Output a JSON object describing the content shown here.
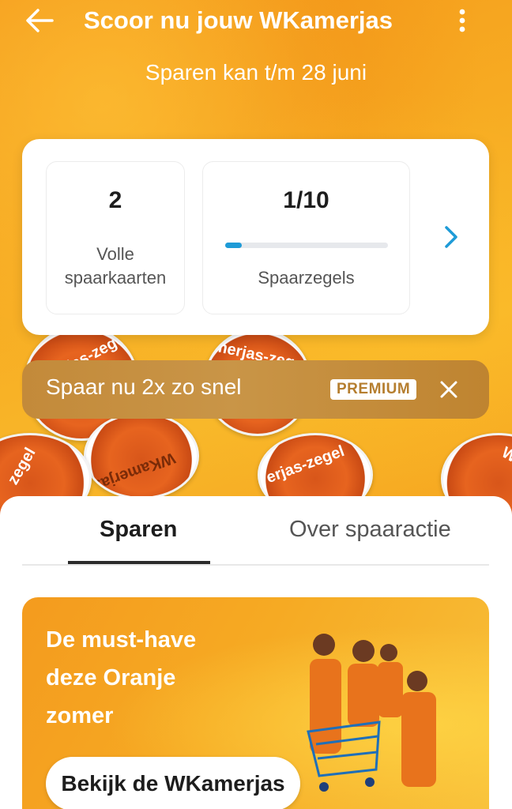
{
  "header": {
    "title": "Scoor nu jouw WKamerjas",
    "subtitle": "Sparen kan t/m 28 juni"
  },
  "stats": {
    "cards": {
      "value": "2",
      "label_line1": "Volle",
      "label_line2": "spaarkaarten"
    },
    "stamps": {
      "value": "1/10",
      "label": "Spaarzegels",
      "progress": 0.1
    }
  },
  "premium": {
    "text": "Spaar nu 2x zo snel",
    "badge": "PREMIUM"
  },
  "stamp_texts": [
    "amerjas-zegel",
    "merjas-zege",
    "WKamerjas",
    "erjas-zegel",
    "zegel",
    "W"
  ],
  "tabs": [
    {
      "label": "Sparen",
      "active": true
    },
    {
      "label": "Over spaaractie",
      "active": false
    }
  ],
  "promo": {
    "title_lines": [
      "De must-have",
      "deze Oranje",
      "zomer"
    ],
    "button_label": "Bekijk de WKamerjas"
  },
  "colors": {
    "accent_orange": "#f7a21e",
    "progress_blue": "#1e9bd7",
    "premium_gold": "#c38a3a"
  },
  "icons": {
    "back": "arrow-left-icon",
    "menu": "more-vertical-icon",
    "next": "chevron-right-icon",
    "close": "close-icon"
  }
}
